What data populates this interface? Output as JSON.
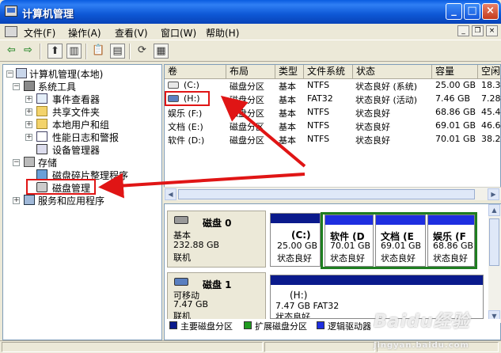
{
  "window": {
    "title": "计算机管理"
  },
  "menu": [
    "文件(F)",
    "操作(A)",
    "查看(V)",
    "窗口(W)",
    "帮助(H)"
  ],
  "tree": {
    "root": "计算机管理(本地)",
    "system_tools": "系统工具",
    "event_viewer": "事件查看器",
    "shared_folders": "共享文件夹",
    "local_users": "本地用户和组",
    "perf_logs": "性能日志和警报",
    "device_manager": "设备管理器",
    "storage": "存储",
    "defrag": "磁盘碎片整理程序",
    "disk_mgmt": "磁盘管理",
    "services": "服务和应用程序"
  },
  "volume_table": {
    "columns": [
      "卷",
      "布局",
      "类型",
      "文件系统",
      "状态",
      "容量",
      "空闲"
    ],
    "rows": [
      {
        "volume": "(C:)",
        "layout": "磁盘分区",
        "type": "基本",
        "fs": "NTFS",
        "status": "状态良好 (系统)",
        "capacity": "25.00 GB",
        "free": "18.3"
      },
      {
        "volume": "(H:)",
        "layout": "磁盘分区",
        "type": "基本",
        "fs": "FAT32",
        "status": "状态良好 (活动)",
        "capacity": "7.46 GB",
        "free": "7.28"
      },
      {
        "volume": "娱乐 (F:)",
        "layout": "磁盘分区",
        "type": "基本",
        "fs": "NTFS",
        "status": "状态良好",
        "capacity": "68.86 GB",
        "free": "45.4"
      },
      {
        "volume": "文档 (E:)",
        "layout": "磁盘分区",
        "type": "基本",
        "fs": "NTFS",
        "status": "状态良好",
        "capacity": "69.01 GB",
        "free": "46.6"
      },
      {
        "volume": "软件 (D:)",
        "layout": "磁盘分区",
        "type": "基本",
        "fs": "NTFS",
        "status": "状态良好",
        "capacity": "70.01 GB",
        "free": "38.2"
      }
    ]
  },
  "disks": [
    {
      "name": "磁盘 0",
      "type": "基本",
      "size": "232.88 GB",
      "state": "联机",
      "partitions": [
        {
          "label": "(C:)",
          "size": "25.00 GB",
          "status": "状态良好"
        },
        {
          "label": "软件  (D",
          "size": "70.01 GB",
          "status": "状态良好"
        },
        {
          "label": "文档  (E",
          "size": "69.01 GB",
          "status": "状态良好"
        },
        {
          "label": "娱乐  (F",
          "size": "68.86 GB",
          "status": "状态良好"
        }
      ]
    },
    {
      "name": "磁盘 1",
      "type": "可移动",
      "size": "7.47 GB",
      "state": "联机",
      "partitions": [
        {
          "label": "(H:)",
          "size": "7.47 GB FAT32",
          "status": "状态良好"
        }
      ]
    }
  ],
  "legend": [
    "主要磁盘分区",
    "扩展磁盘分区",
    "逻辑驱动器"
  ],
  "colors": {
    "primary": "#0a1a8c",
    "extended": "#1f9b1f",
    "logical": "#1e2ee0",
    "annotation": "#e01515"
  },
  "watermark": {
    "text": "Baidu经验",
    "sub": "jingyan.baidu.com"
  }
}
